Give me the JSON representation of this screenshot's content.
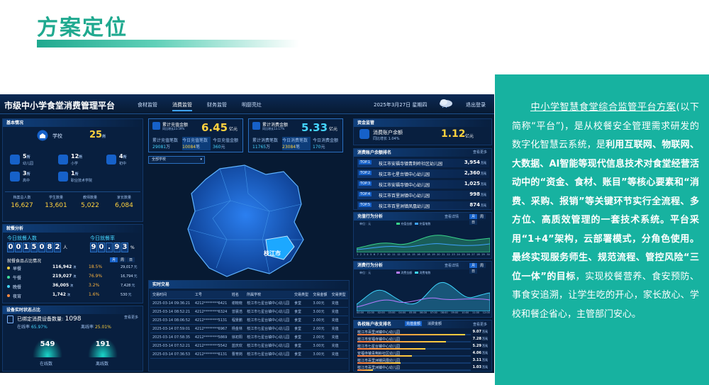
{
  "slide": {
    "title": "方案定位"
  },
  "dashboard": {
    "title": "市级中小学食堂消费管理平台",
    "nav": [
      "食材监管",
      "消费监管",
      "财务监管",
      "明厨亮灶"
    ],
    "active_nav": "消费监管",
    "date": "2025年3月27日",
    "weekday": "星期四",
    "logout": "退出登录",
    "basic": {
      "header": "基本情况",
      "school_label": "学校",
      "school_count": "25",
      "school_unit": "所",
      "levels": [
        {
          "count": "5",
          "unit": "所",
          "label": "幼儿园"
        },
        {
          "count": "12",
          "unit": "所",
          "label": "小学"
        },
        {
          "count": "4",
          "unit": "所",
          "label": "初中"
        },
        {
          "count": "3",
          "unit": "所",
          "label": "高中"
        },
        {
          "count": "1",
          "unit": "所",
          "label": "职业技术学院"
        }
      ],
      "stats": [
        {
          "label": "档案总人数",
          "value": "16,627"
        },
        {
          "label": "学生数量",
          "value": "13,601"
        },
        {
          "label": "教师数量",
          "value": "5,022"
        },
        {
          "label": "家长数量",
          "value": "6,084"
        }
      ]
    },
    "dining": {
      "header": "就餐分析",
      "today_people_label": "今日就餐人数",
      "today_people_digits": [
        "0",
        "0",
        "1",
        "5",
        "0",
        "8",
        "2"
      ],
      "today_people_unit": "人",
      "today_rate_label": "今日就餐率",
      "today_rate_digits": [
        "9",
        "0",
        ".",
        "9",
        "3"
      ],
      "today_rate_unit": "%",
      "ratio_header": "就餐食品占比情况",
      "tabs": [
        "月",
        "周",
        "日"
      ],
      "meals": [
        {
          "name": "早餐",
          "count": "116,942",
          "unit": "次",
          "pct": "18.5%",
          "amount": "29,017",
          "amount_unit": "元",
          "fill": 0.18
        },
        {
          "name": "午餐",
          "count": "219,027",
          "unit": "次",
          "pct": "76.9%",
          "amount": "16,794",
          "amount_unit": "元",
          "fill": 0.77
        },
        {
          "name": "晚餐",
          "count": "36,005",
          "unit": "次",
          "pct": "3.2%",
          "amount": "7,428",
          "amount_unit": "元",
          "fill": 0.03
        },
        {
          "name": "夜宵",
          "count": "1,742",
          "unit": "次",
          "pct": "1.6%",
          "amount": "530",
          "amount_unit": "元",
          "fill": 0.02
        }
      ]
    },
    "devices": {
      "header": "设备实时状态占比",
      "more": "查看更多",
      "bound_label": "已绑定消费设备数量:",
      "bound_count": "1098",
      "online_rate_label": "在线率",
      "online_rate": "65.97%",
      "offline_rate_label": "离线率",
      "offline_rate": "25.01%",
      "online_count": "549",
      "online_label": "在线数",
      "offline_count": "191",
      "offline_label": "离线数"
    },
    "recharge": {
      "label": "累计充值金额",
      "compare": "同比增长23.59%",
      "value": "6.45",
      "unit": "亿元",
      "sub1_label": "累计充值笔数",
      "sub1_value": "29081",
      "sub1_unit": "万",
      "sub2_label": "今日充值笔数",
      "sub2_value": "10084",
      "sub2_unit": "笔",
      "sub3_label": "今日充值金额",
      "sub3_value": "360",
      "sub3_unit": "元"
    },
    "consume": {
      "label": "累计消费金额",
      "compare": "同比增长13.17%",
      "value": "5.33",
      "unit": "亿元",
      "sub1_label": "累计消费笔数",
      "sub1_value": "11765",
      "sub1_unit": "万",
      "sub2_label": "今日消费笔数",
      "sub2_value": "23084",
      "sub2_unit": "笔",
      "sub3_label": "今日消费金额",
      "sub3_value": "170",
      "sub3_unit": "元"
    },
    "map": {
      "select": "全部学校",
      "city_label": "枝江市"
    },
    "transactions": {
      "header": "实时交易",
      "columns": [
        "交易时间",
        "工号",
        "姓名",
        "所属学校",
        "交易类型",
        "交易金额",
        "交易类型"
      ],
      "rows": [
        [
          "2025-03-14 09:36:21",
          "4212********6421",
          "谢晓晓",
          "枝江市七星台镇中心幼儿园",
          "食堂",
          "3.00元",
          "充值"
        ],
        [
          "2025-03-14 08:52:21",
          "4212********6324",
          "曾晨浩",
          "枝江市七星台镇中心幼儿园",
          "食堂",
          "3.00元",
          "充值"
        ],
        [
          "2025-03-14 08:06:52",
          "4212********5131",
          "程景鹏",
          "枝江市七星台镇中心幼儿园",
          "食堂",
          "2.00元",
          "充值"
        ],
        [
          "2025-03-14 07:59:01",
          "4212********6967",
          "杨金林",
          "枝江市七星台镇中心幼儿园",
          "食堂",
          "2.00元",
          "充值"
        ],
        [
          "2025-03-14 07:58:35",
          "4212********5869",
          "徐初阳",
          "枝江市七星台镇中心幼儿园",
          "食堂",
          "2.00元",
          "充值"
        ],
        [
          "2025-03-14 07:52:21",
          "4212********5542",
          "蓝庆欢",
          "枝江市七星台镇中心幼儿园",
          "食堂",
          "3.00元",
          "充值"
        ],
        [
          "2025-03-14 07:36:53",
          "4212********6131",
          "曹育岗",
          "枝江市七星台镇中心幼儿园",
          "食堂",
          "3.00元",
          "充值"
        ]
      ]
    },
    "funds": {
      "header": "资金监管",
      "balance_label": "消费账户余额",
      "balance_compare": "同比增长 1.04%",
      "balance_value": "1.12",
      "balance_unit": "亿元"
    },
    "ranking": {
      "header": "消费账户余额排名",
      "more": "查看更多",
      "items": [
        {
          "rank": "TOP.1",
          "name": "枝江市安福寺镇青荆岭社区幼儿园",
          "value": "3,954",
          "unit": "万元"
        },
        {
          "rank": "TOP.2",
          "name": "枝江市七星台镇中心幼儿园",
          "value": "2,360",
          "unit": "万元"
        },
        {
          "rank": "TOP.3",
          "name": "枝江市安福寺镇中心幼儿园",
          "value": "1,025",
          "unit": "万元"
        },
        {
          "rank": "TOP.4",
          "name": "枝江市百里洲镇中心幼儿园",
          "value": "998",
          "unit": "万元"
        },
        {
          "rank": "TOP.5",
          "name": "枝江市百里洲镇凤凰幼儿园",
          "value": "874",
          "unit": "万元"
        }
      ]
    },
    "recharge_trend": {
      "header": "充值行为分析",
      "more": "查看详情",
      "unit_label": "单位：元",
      "legend": [
        "充值金额",
        "充值笔数"
      ],
      "tabs": [
        "月",
        "周",
        "日"
      ],
      "x": [
        "1",
        "2",
        "3",
        "4",
        "5",
        "6",
        "7",
        "8",
        "9",
        "10",
        "11",
        "12",
        "13",
        "14",
        "15",
        "16",
        "17",
        "18",
        "19",
        "20",
        "21",
        "22",
        "23",
        "24",
        "25",
        "26",
        "27",
        "28",
        "29",
        "30"
      ]
    },
    "consume_trend": {
      "header": "消费行为分析",
      "more": "查看详情",
      "unit_label": "单位：元",
      "legend": [
        "消费金额",
        "消费笔数"
      ],
      "tabs": [
        "月",
        "周",
        "日"
      ],
      "x": [
        "00:00",
        "01:00",
        "02:00",
        "03:00",
        "04:00",
        "05:00",
        "06:00",
        "07:00",
        "08:00",
        "09:00",
        "10:00",
        "11:00",
        "12:00"
      ]
    },
    "school_rank": {
      "header": "各校账户收支排名",
      "tabs": [
        "充值金额",
        "消费金额"
      ],
      "more": "查看更多",
      "items": [
        {
          "name": "枝江市百里洲镇中心幼儿园",
          "value": "9.07",
          "unit": "万元",
          "fill": 0.95
        },
        {
          "name": "枝江市安福寺镇中心幼儿园",
          "value": "7.28",
          "unit": "万元",
          "fill": 0.78
        },
        {
          "name": "枝江市七星台镇中心幼儿园",
          "value": "5.29",
          "unit": "万元",
          "fill": 0.6
        },
        {
          "name": "安福寺镇青荆岭社区幼儿园",
          "value": "4.06",
          "unit": "万元",
          "fill": 0.48
        },
        {
          "name": "枝江市百里洲镇凤凰幼儿园",
          "value": "3.11",
          "unit": "万元",
          "fill": 0.38
        },
        {
          "name": "枝江市百里洲镇中心幼儿园",
          "value": "1.03",
          "unit": "万元",
          "fill": 0.14
        }
      ]
    }
  },
  "description": {
    "part1_underline": "中小学智慧食堂综合监管平台方案",
    "part2": "(以下简称“平台”)，是从校餐安全管理需求研发的数字化智慧云系统，是",
    "part3_bold": "利用互联网、物联网、大数据、AI智能等现代信息技术对食堂经营活动中的“资金、食材、账目”等核心要素和“消费、采购、报销”等关键环节实行全流程、多方位、高质效管理的一套技术系统。平台采用“1+4”架构，云部署模式，分角色使用。最终实现服务师生、规范流程、管控风险“三位一体”的目标",
    "part4": "，实现校餐营养、食安预防、事食安追溯，让学生吃的开心，家长放心、学校和餐企省心，主管部门安心。"
  }
}
